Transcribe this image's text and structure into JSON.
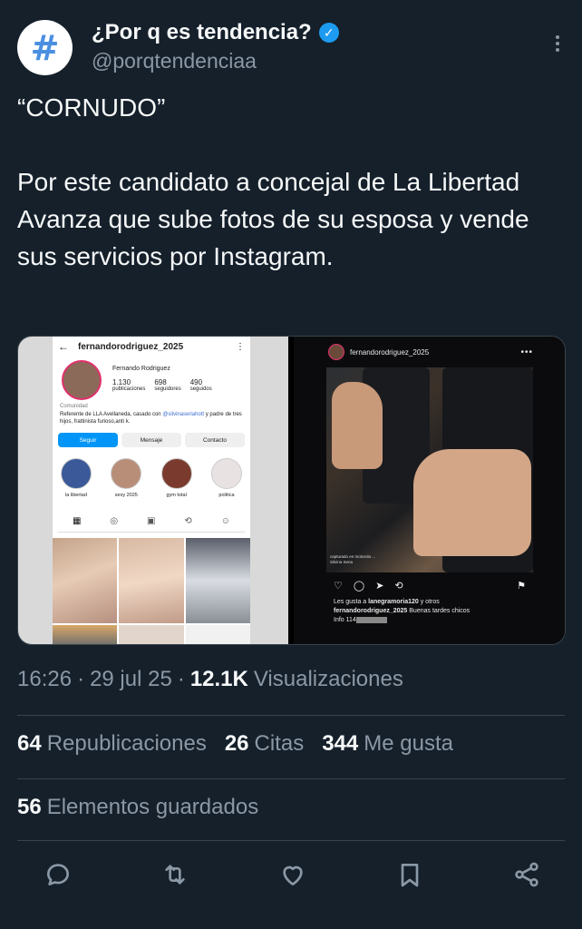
{
  "author": {
    "avatar_symbol": "#",
    "display_name": "¿Por q es tendencia?",
    "handle": "@porqtendenciaa",
    "verified": true
  },
  "tweet": {
    "line1": "“CORNUDO”",
    "line2": "Por este candidato a concejal de La Libertad Avanza que sube fotos de su esposa y vende sus servicios por Instagram."
  },
  "media": {
    "left": {
      "username": "fernandorodriguez_2025",
      "full_name": "Fernando Rodriguez",
      "stats": [
        {
          "value": "1.130",
          "label": "publicaciones"
        },
        {
          "value": "698",
          "label": "seguidores"
        },
        {
          "value": "490",
          "label": "seguidos"
        }
      ],
      "category": "Comunidad",
      "bio_start": "Referente de LLA Avellaneda, casado con ",
      "bio_mention": "@silvinaseriahott",
      "bio_end": " y padre de tres hijos, frattinista furioso,anti k.",
      "buttons": [
        "Seguir",
        "Mensaje",
        "Contacto"
      ],
      "highlights": [
        "la libertad",
        "sexy 2025",
        "gym total",
        "politica"
      ]
    },
    "right": {
      "username": "fernandorodriguez_2025",
      "photo_caption": "capturado en motorola ...\nSilvina Sena",
      "likes_prefix": "Les gusta a ",
      "likes_user": "lanegramoria120",
      "likes_suffix": " y otros",
      "caption_user": "fernandorodriguez_2025",
      "caption_text": " Buenas tardes chicos",
      "info": "Info 114"
    }
  },
  "meta": {
    "time": "16:26",
    "date": "29 jul 25",
    "views_count": "12.1K",
    "views_label": "Visualizaciones"
  },
  "stats": {
    "reposts_count": "64",
    "reposts_label": "Republicaciones",
    "quotes_count": "26",
    "quotes_label": "Citas",
    "likes_count": "344",
    "likes_label": "Me gusta",
    "bookmarks_count": "56",
    "bookmarks_label": "Elementos guardados"
  },
  "icons": {
    "reply": "reply-icon",
    "repost": "repost-icon",
    "like": "heart-icon",
    "bookmark": "bookmark-icon",
    "share": "share-icon"
  },
  "colors": {
    "background": "#15202b",
    "text": "#f7f9f9",
    "muted": "#8b98a5",
    "verified": "#1d9bf0"
  }
}
